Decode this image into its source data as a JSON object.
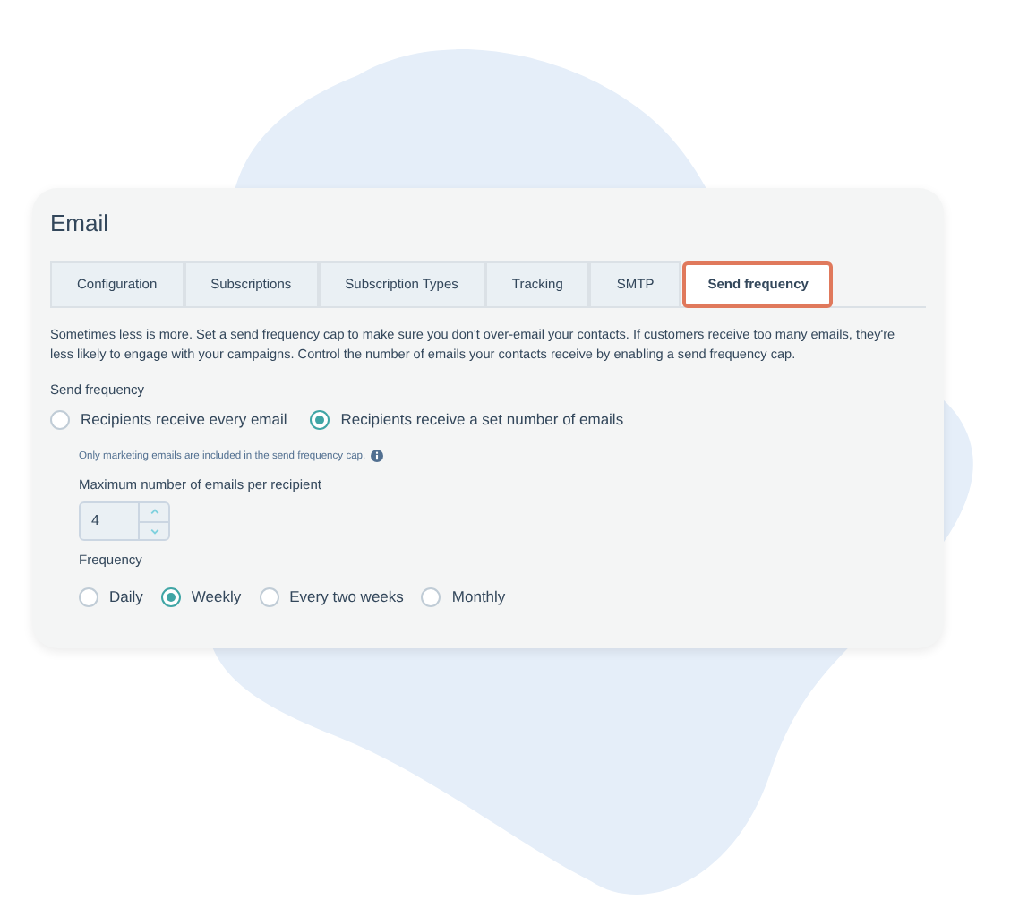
{
  "title": "Email",
  "tabs": [
    {
      "label": "Configuration",
      "selected": false
    },
    {
      "label": "Subscriptions",
      "selected": false
    },
    {
      "label": "Subscription Types",
      "selected": false
    },
    {
      "label": "Tracking",
      "selected": false
    },
    {
      "label": "SMTP",
      "selected": false
    },
    {
      "label": "Send frequency",
      "selected": true
    }
  ],
  "description": "Sometimes less is more. Set a send frequency cap to make sure you don't over-email your contacts. If customers receive too many emails, they're less likely to engage with your campaigns. Control the number of emails your contacts receive by enabling a send frequency cap.",
  "send_frequency": {
    "label": "Send frequency",
    "options": [
      {
        "label": "Recipients receive every email",
        "selected": false
      },
      {
        "label": "Recipients receive a set number of emails",
        "selected": true
      }
    ]
  },
  "note": "Only marketing emails are included in the send frequency cap.",
  "max_emails": {
    "label": "Maximum number of emails per recipient",
    "value": "4"
  },
  "frequency": {
    "label": "Frequency",
    "options": [
      {
        "label": "Daily",
        "selected": false
      },
      {
        "label": "Weekly",
        "selected": true
      },
      {
        "label": "Every two weeks",
        "selected": false
      },
      {
        "label": "Monthly",
        "selected": false
      }
    ]
  }
}
